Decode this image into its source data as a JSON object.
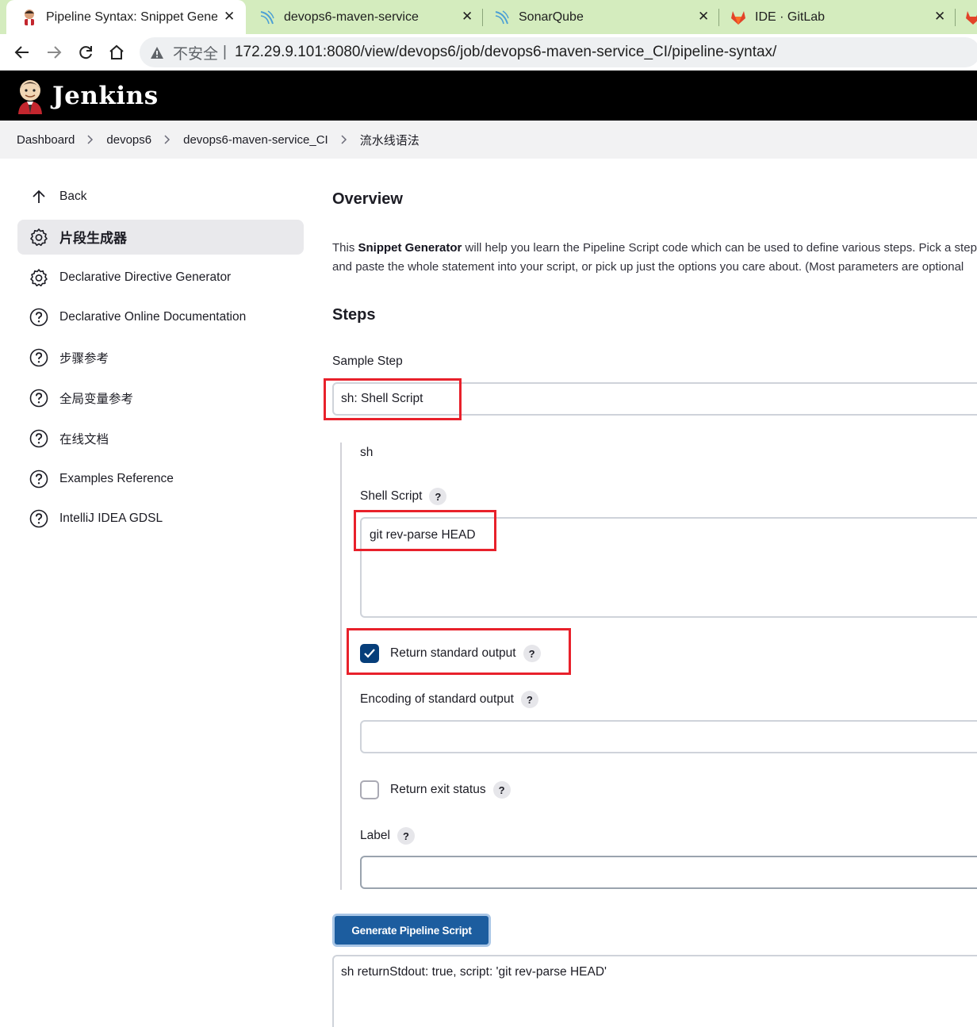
{
  "browser": {
    "tabs": [
      {
        "title": "Pipeline Syntax: Snippet Generator",
        "favicon": "jenkins-icon",
        "active": true
      },
      {
        "title": "devops6-maven-service",
        "favicon": "sonarqube-icon",
        "active": false
      },
      {
        "title": "SonarQube",
        "favicon": "sonarqube-icon",
        "active": false
      },
      {
        "title": "IDE · GitLab",
        "favicon": "gitlab-icon",
        "active": false
      }
    ],
    "close_glyph": "✕",
    "address": {
      "security_label": "不安全",
      "separator": "|",
      "host": "172.29.9.101",
      "path": ":8080/view/devops6/job/devops6-maven-service_CI/pipeline-syntax/"
    }
  },
  "header": {
    "brand": "Jenkins"
  },
  "breadcrumbs": [
    "Dashboard",
    "devops6",
    "devops6-maven-service_CI",
    "流水线语法"
  ],
  "sidebar": {
    "items": [
      {
        "label": "Back",
        "icon": "arrow-up-icon"
      },
      {
        "label": "片段生成器",
        "icon": "gear-icon",
        "active": true
      },
      {
        "label": "Declarative Directive Generator",
        "icon": "gear-icon"
      },
      {
        "label": "Declarative Online Documentation",
        "icon": "help-circle-icon"
      },
      {
        "label": "步骤参考",
        "icon": "help-circle-icon"
      },
      {
        "label": "全局变量参考",
        "icon": "help-circle-icon"
      },
      {
        "label": "在线文档",
        "icon": "help-circle-icon"
      },
      {
        "label": "Examples Reference",
        "icon": "help-circle-icon"
      },
      {
        "label": "IntelliJ IDEA GDSL",
        "icon": "help-circle-icon"
      }
    ]
  },
  "main": {
    "overview_title": "Overview",
    "description": {
      "prefix": "This ",
      "bold": "Snippet Generator",
      "line1_rest": " will help you learn the Pipeline Script code which can be used to define various steps. Pick a step",
      "line2": "and paste the whole statement into your script, or pick up just the options you care about. (Most parameters are optional"
    },
    "steps_title": "Steps",
    "sample_step_label": "Sample Step",
    "sample_step_value": "sh: Shell Script",
    "step_name": "sh",
    "help_glyph": "?",
    "shell_script": {
      "label": "Shell Script",
      "value": "git rev-parse HEAD"
    },
    "return_stdout": {
      "label": "Return standard output",
      "checked": true
    },
    "encoding": {
      "label": "Encoding of standard output",
      "value": ""
    },
    "return_status": {
      "label": "Return exit status",
      "checked": false
    },
    "label_field": {
      "label": "Label",
      "value": ""
    },
    "generate_button": "Generate Pipeline Script",
    "output": "sh returnStdout: true, script: 'git rev-parse HEAD'"
  },
  "colors": {
    "tabstrip": "#d4ecbe",
    "header": "#000000",
    "accent": "#063e7a",
    "button": "#1c5d9f",
    "highlight": "#e8212b"
  }
}
